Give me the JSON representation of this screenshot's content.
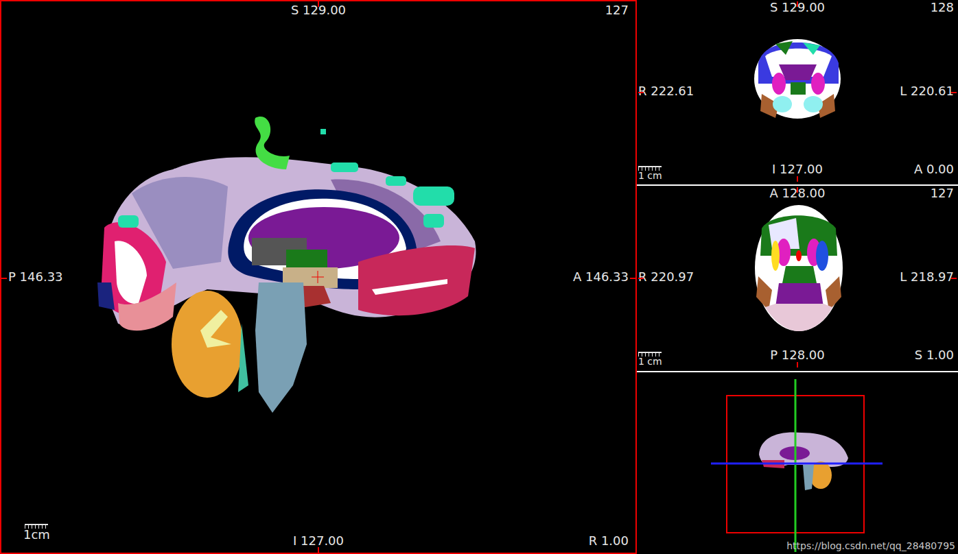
{
  "views": [
    {
      "top": "S 129.00",
      "corner": "127",
      "left": "P 146.33",
      "right": "A 146.33",
      "bottom": "I 127.00",
      "bottom_right": "R 1.00",
      "scale": "1cm",
      "selected": true
    },
    {
      "top": "S 129.00",
      "corner": "128",
      "left": "R 222.61",
      "right": "L 220.61",
      "bottom": "I 127.00",
      "bottom_right": "A 0.00",
      "scale": "1 cm",
      "selected": false
    },
    {
      "top": "A 128.00",
      "corner": "127",
      "left": "R 220.97",
      "right": "L 218.97",
      "bottom": "P 128.00",
      "bottom_right": "S 1.00",
      "scale": "1 cm",
      "selected": false
    }
  ],
  "watermark": "https://blog.csdn.net/qq_28480795"
}
